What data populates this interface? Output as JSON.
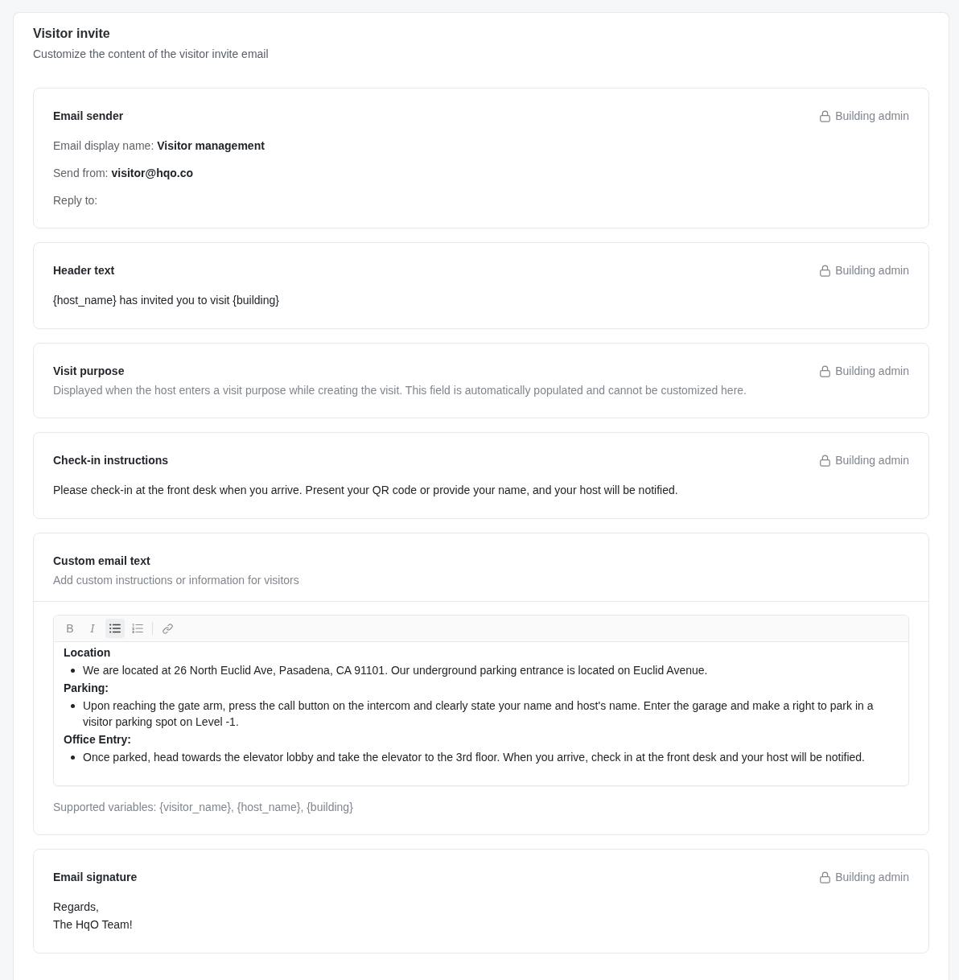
{
  "page": {
    "title": "Visitor invite",
    "subtitle": "Customize the content of the visitor invite email"
  },
  "sections": [
    {
      "kind": "fields",
      "title": "Email sender",
      "permission": "Building admin",
      "fields": [
        {
          "label": "Email display name:",
          "value": "Visitor management"
        },
        {
          "label": "Send from:",
          "value": "visitor@hqo.co"
        },
        {
          "label": "Reply to:"
        }
      ]
    },
    {
      "kind": "text",
      "title": "Header text",
      "permission": "Building admin",
      "lines": [
        "{host_name} has invited you to visit {building}"
      ]
    },
    {
      "kind": "description",
      "title": "Visit purpose",
      "permission": "Building admin",
      "description": "Displayed when the host enters a visit purpose while creating the visit. This field is automatically populated and cannot be customized here."
    },
    {
      "kind": "text",
      "title": "Check-in instructions",
      "permission": "Building admin",
      "lines": [
        "Please check-in at the front desk when you arrive. Present your QR code or provide your name, and your host will be notified."
      ]
    },
    {
      "kind": "editor",
      "title": "Custom email text",
      "description": "Add custom instructions or information for visitors",
      "toolbar_groups": [
        {
          "buttons": [
            {
              "kind": "bold",
              "label": "B",
              "selected": false
            },
            {
              "kind": "italic",
              "label": "I",
              "selected": false
            },
            {
              "kind": "bullet_list",
              "selected": true
            },
            {
              "kind": "ordered_list",
              "selected": false
            }
          ]
        },
        {
          "buttons": [
            {
              "kind": "link",
              "selected": false
            }
          ]
        }
      ],
      "content": [
        {
          "heading": "Location",
          "items": [
            "We are located at 26 North Euclid Ave, Pasadena, CA 91101. Our underground parking entrance is located on Euclid Avenue."
          ]
        },
        {
          "heading": "Parking:",
          "items": [
            "Upon reaching the gate arm, press the call button on the intercom and clearly state your name and host's name. Enter the garage and make a right to park in a visitor parking spot on Level -1."
          ]
        },
        {
          "heading": "Office Entry:",
          "items": [
            "Once parked, head towards the elevator lobby and take the elevator to the 3rd floor. When you arrive, check in at the front desk and your host will be notified."
          ]
        }
      ],
      "note": "Supported variables: {visitor_name}, {host_name}, {building}"
    },
    {
      "kind": "text",
      "title": "Email signature",
      "permission": "Building admin",
      "lines": [
        "Regards,",
        "The HqO Team!"
      ]
    }
  ]
}
